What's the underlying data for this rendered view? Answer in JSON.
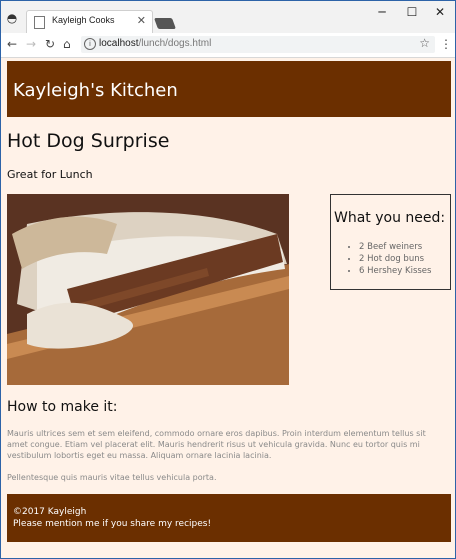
{
  "browser": {
    "tab_title": "Kayleigh Cooks",
    "url_host": "localhost",
    "url_path": "/lunch/dogs.html"
  },
  "site": {
    "title": "Kayleigh's Kitchen"
  },
  "recipe": {
    "title": "Hot Dog Surprise",
    "subtitle": "Great for Lunch",
    "needs_title": "What you need:",
    "ingredients": [
      "2 Beef weiners",
      "2 Hot dog buns",
      "6 Hershey Kisses"
    ],
    "howto_title": "How to make it:",
    "paragraph1": "Mauris ultrices sem et sem eleifend, commodo ornare eros dapibus. Proin interdum elementum tellus sit amet congue. Etiam vel placerat elit. Mauris hendrerit risus ut vehicula gravida. Nunc eu tortor quis mi vestibulum lobortis eget eu massa. Aliquam ornare lacinia lacinia.",
    "paragraph2": "Pellentesque quis mauris vitae tellus vehicula porta."
  },
  "footer": {
    "line1": "©2017 Kayleigh",
    "line2": "Please mention me if you share my recipes!"
  },
  "icons": {
    "incognito": "incognito-icon",
    "back": "back-arrow-icon",
    "forward": "forward-arrow-icon",
    "reload": "reload-icon",
    "home": "home-icon",
    "info": "info-icon",
    "star": "star-icon",
    "menu": "menu-dots-icon"
  },
  "colors": {
    "header_bg": "#6b2f00",
    "page_bg": "#fff2e8"
  }
}
